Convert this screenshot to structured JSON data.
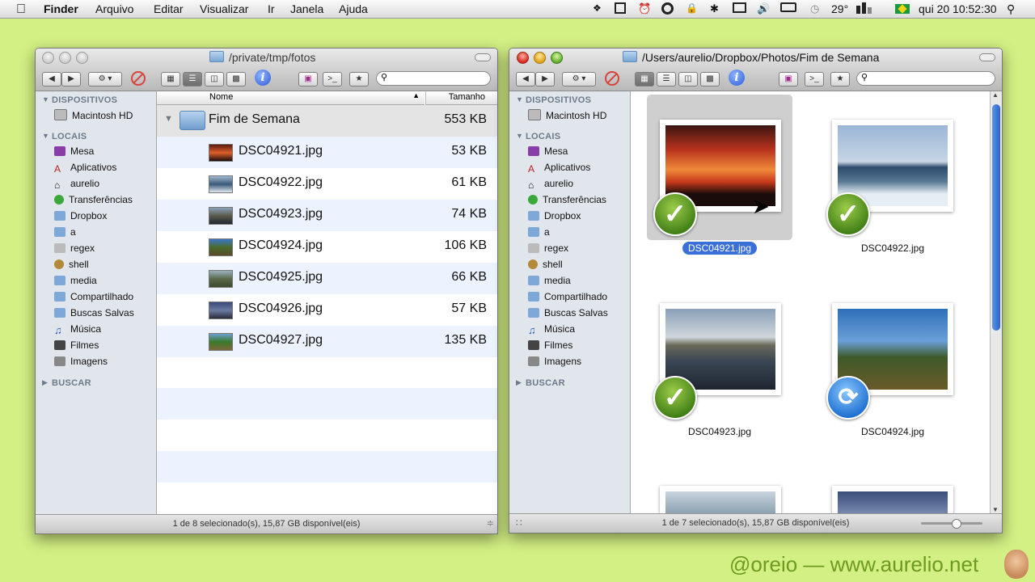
{
  "menubar": {
    "apple": "",
    "items": [
      "Finder",
      "Arquivo",
      "Editar",
      "Visualizar",
      "Ir",
      "Janela",
      "Ajuda"
    ],
    "temperature": "29°",
    "clock": "qui 20 10:52:30"
  },
  "left_window": {
    "title": "/private/tmp/fotos",
    "columns": {
      "name": "Nome",
      "size": "Tamanho"
    },
    "folder": {
      "name": "Fim de Semana",
      "size": "553 KB"
    },
    "files": [
      {
        "name": "DSC04921.jpg",
        "size": "53 KB"
      },
      {
        "name": "DSC04922.jpg",
        "size": "61 KB"
      },
      {
        "name": "DSC04923.jpg",
        "size": "74 KB"
      },
      {
        "name": "DSC04924.jpg",
        "size": "106 KB"
      },
      {
        "name": "DSC04925.jpg",
        "size": "66 KB"
      },
      {
        "name": "DSC04926.jpg",
        "size": "57 KB"
      },
      {
        "name": "DSC04927.jpg",
        "size": "135 KB"
      }
    ],
    "status": "1 de 8 selecionado(s), 15,87 GB disponível(eis)"
  },
  "right_window": {
    "title": "/Users/aurelio/Dropbox/Photos/Fim de Semana",
    "photos": [
      {
        "name": "DSC04921.jpg",
        "badge": "check",
        "selected": true
      },
      {
        "name": "DSC04922.jpg",
        "badge": "check",
        "selected": false
      },
      {
        "name": "DSC04923.jpg",
        "badge": "check",
        "selected": false
      },
      {
        "name": "DSC04924.jpg",
        "badge": "sync",
        "selected": false
      }
    ],
    "status": "1 de 7 selecionado(s), 15,87 GB disponível(eis)"
  },
  "sidebar": {
    "devices_header": "DISPOSITIVOS",
    "devices": [
      "Macintosh HD"
    ],
    "places_header": "LOCAIS",
    "places": [
      "Mesa",
      "Aplicativos",
      "aurelio",
      "Transferências",
      "Dropbox",
      "a",
      "regex",
      "shell",
      "media",
      "Compartilhado",
      "Buscas Salvas",
      "Música",
      "Filmes",
      "Imagens"
    ],
    "search_header": "BUSCAR"
  },
  "toolbar": {
    "terminal": ">_",
    "star": "★"
  },
  "watermark": "@oreio — www.aurelio.net"
}
